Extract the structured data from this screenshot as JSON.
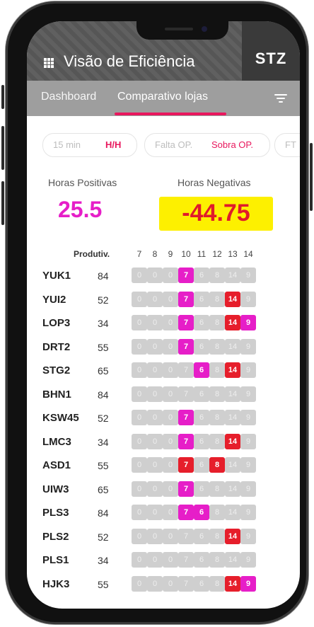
{
  "app": {
    "title": "Visão de Eficiência",
    "brand": "STZ"
  },
  "tabs": [
    {
      "label": "Dashboard",
      "active": false
    },
    {
      "label": "Comparativo lojas",
      "active": true
    }
  ],
  "segments": {
    "group1": {
      "opt1": "15 min",
      "opt2": "H/H",
      "selected": "H/H"
    },
    "group2": {
      "opt1": "Falta OP.",
      "opt2": "Sobra OP.",
      "selected": "Sobra OP."
    },
    "group3": {
      "opt1": "FT"
    }
  },
  "summary": {
    "positive_label": "Horas Positivas",
    "positive_value": "25.5",
    "negative_label": "Horas Negativas",
    "negative_value": "-44.75"
  },
  "table": {
    "prod_header": "Produtiv.",
    "hours": [
      "7",
      "8",
      "9",
      "10",
      "11",
      "12",
      "13",
      "14"
    ],
    "rows": [
      {
        "code": "YUK1",
        "prod": "84",
        "values": [
          "0",
          "0",
          "0",
          "7",
          "6",
          "8",
          "14",
          "9"
        ],
        "highlight": [
          "",
          "",
          "",
          "pink",
          "",
          "",
          "",
          ""
        ]
      },
      {
        "code": "YUI2",
        "prod": "52",
        "values": [
          "0",
          "0",
          "0",
          "7",
          "6",
          "8",
          "14",
          "9"
        ],
        "highlight": [
          "",
          "",
          "",
          "pink",
          "",
          "",
          "red",
          ""
        ]
      },
      {
        "code": "LOP3",
        "prod": "34",
        "values": [
          "0",
          "0",
          "0",
          "7",
          "6",
          "8",
          "14",
          "9"
        ],
        "highlight": [
          "",
          "",
          "",
          "pink",
          "",
          "",
          "red",
          "pink"
        ]
      },
      {
        "code": "DRT2",
        "prod": "55",
        "values": [
          "0",
          "0",
          "0",
          "7",
          "6",
          "8",
          "14",
          "9"
        ],
        "highlight": [
          "",
          "",
          "",
          "pink",
          "",
          "",
          "",
          ""
        ]
      },
      {
        "code": "STG2",
        "prod": "65",
        "values": [
          "0",
          "0",
          "0",
          "7",
          "6",
          "8",
          "14",
          "9"
        ],
        "highlight": [
          "",
          "",
          "",
          "",
          "pink",
          "",
          "red",
          ""
        ]
      },
      {
        "code": "BHN1",
        "prod": "84",
        "values": [
          "0",
          "0",
          "0",
          "7",
          "6",
          "8",
          "14",
          "9"
        ],
        "highlight": [
          "",
          "",
          "",
          "",
          "",
          "",
          "",
          ""
        ]
      },
      {
        "code": "KSW45",
        "prod": "52",
        "values": [
          "0",
          "0",
          "0",
          "7",
          "6",
          "8",
          "14",
          "9"
        ],
        "highlight": [
          "",
          "",
          "",
          "pink",
          "",
          "",
          "",
          ""
        ]
      },
      {
        "code": "LMC3",
        "prod": "34",
        "values": [
          "0",
          "0",
          "0",
          "7",
          "6",
          "8",
          "14",
          "9"
        ],
        "highlight": [
          "",
          "",
          "",
          "pink",
          "",
          "",
          "red",
          ""
        ]
      },
      {
        "code": "ASD1",
        "prod": "55",
        "values": [
          "0",
          "0",
          "0",
          "7",
          "6",
          "8",
          "14",
          "9"
        ],
        "highlight": [
          "",
          "",
          "",
          "red",
          "",
          "red",
          "",
          ""
        ]
      },
      {
        "code": "UIW3",
        "prod": "65",
        "values": [
          "0",
          "0",
          "0",
          "7",
          "6",
          "8",
          "14",
          "9"
        ],
        "highlight": [
          "",
          "",
          "",
          "pink",
          "",
          "",
          "",
          ""
        ]
      },
      {
        "code": "PLS3",
        "prod": "84",
        "values": [
          "0",
          "0",
          "0",
          "7",
          "6",
          "8",
          "14",
          "9"
        ],
        "highlight": [
          "",
          "",
          "",
          "pink",
          "pink",
          "",
          "",
          ""
        ]
      },
      {
        "code": "PLS2",
        "prod": "52",
        "values": [
          "0",
          "0",
          "0",
          "7",
          "6",
          "8",
          "14",
          "9"
        ],
        "highlight": [
          "",
          "",
          "",
          "",
          "",
          "",
          "red",
          ""
        ]
      },
      {
        "code": "PLS1",
        "prod": "34",
        "values": [
          "0",
          "0",
          "0",
          "7",
          "6",
          "8",
          "14",
          "9"
        ],
        "highlight": [
          "",
          "",
          "",
          "",
          "",
          "",
          "",
          ""
        ]
      },
      {
        "code": "HJK3",
        "prod": "55",
        "values": [
          "0",
          "0",
          "0",
          "7",
          "6",
          "8",
          "14",
          "9"
        ],
        "highlight": [
          "",
          "",
          "",
          "",
          "",
          "",
          "red",
          "pink"
        ]
      }
    ]
  },
  "icons": {
    "menu": "grid-menu-icon",
    "filter": "filter-icon"
  },
  "colors": {
    "accent": "#e8175d",
    "pink": "#e61ec8",
    "red": "#e61e2b",
    "yellow": "#fdf000"
  }
}
